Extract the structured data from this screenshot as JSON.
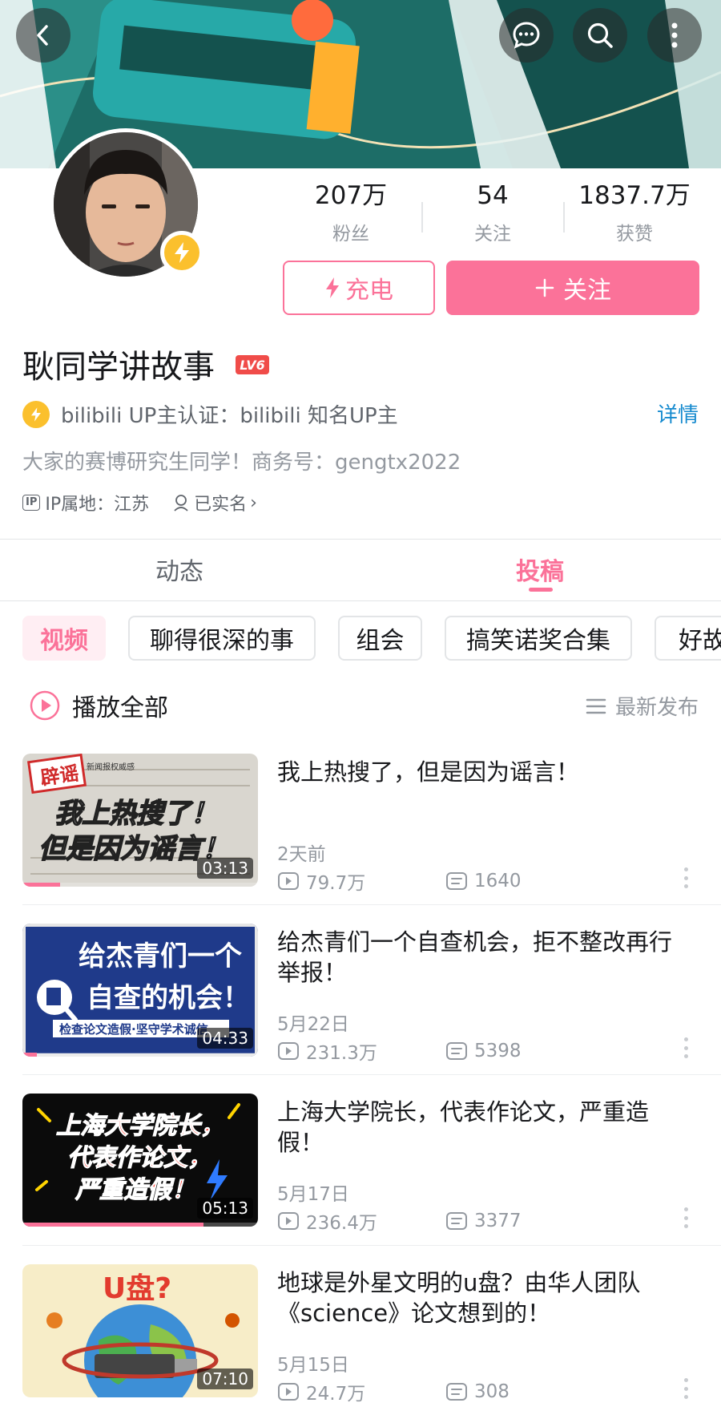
{
  "header": {
    "back_icon": "back-arrow-icon",
    "actions": [
      "chat-bubble-icon",
      "search-icon",
      "more-vertical-icon"
    ]
  },
  "profile": {
    "stats": [
      {
        "value": "207万",
        "label": "粉丝"
      },
      {
        "value": "54",
        "label": "关注"
      },
      {
        "value": "1837.7万",
        "label": "获赞"
      }
    ],
    "charge_label": "充电",
    "follow_label": "关注",
    "name": "耿同学讲故事",
    "level": "LV6",
    "cert_text": "bilibili UP主认证：bilibili 知名UP主",
    "detail_label": "详情",
    "bio": "大家的赛博研究生同学！商务号：gengtx2022",
    "ip_badge": "IP",
    "ip_location": "IP属地：江苏",
    "real_name": "已实名",
    "real_name_arrow": "›"
  },
  "tabs": [
    {
      "label": "动态",
      "active": false
    },
    {
      "label": "投稿",
      "active": true
    }
  ],
  "chips": [
    "视频",
    "聊得很深的事",
    "组会",
    "搞笑诺奖合集",
    "好故"
  ],
  "play_all": {
    "label": "播放全部",
    "sort_label": "最新发布"
  },
  "videos": [
    {
      "title": "我上热搜了，但是因为谣言！",
      "date": "2天前",
      "views": "79.7万",
      "comments": "1640",
      "duration": "03:13",
      "progress": 0.16,
      "thumb_text": [
        "我上热搜了！",
        "但是因为谣言！"
      ],
      "thumb_tag": "辟谣",
      "thumb_header": "新闻报权威感"
    },
    {
      "title": "给杰青们一个自查机会，拒不整改再行举报！",
      "date": "5月22日",
      "views": "231.3万",
      "comments": "5398",
      "duration": "04:33",
      "progress": 0.06,
      "thumb_text": [
        "给杰青们一个",
        "自查的机会！"
      ],
      "thumb_sub": "检查论文造假·坚守学术诚信"
    },
    {
      "title": "上海大学院长，代表作论文，严重造假！",
      "date": "5月17日",
      "views": "236.4万",
      "comments": "3377",
      "duration": "05:13",
      "progress": 0.77,
      "thumb_text": [
        "上海大学院长，",
        "代表作论文，",
        "严重造假！"
      ]
    },
    {
      "title": "地球是外星文明的u盘？由华人团队《science》论文想到的！",
      "date": "5月15日",
      "views": "24.7万",
      "comments": "308",
      "duration": "07:10",
      "progress": 0,
      "thumb_text": [
        "U盘?"
      ]
    }
  ],
  "colors": {
    "accent": "#fb7299",
    "link": "#178bcf",
    "gold": "#fbc02d",
    "muted": "#9499a0"
  }
}
